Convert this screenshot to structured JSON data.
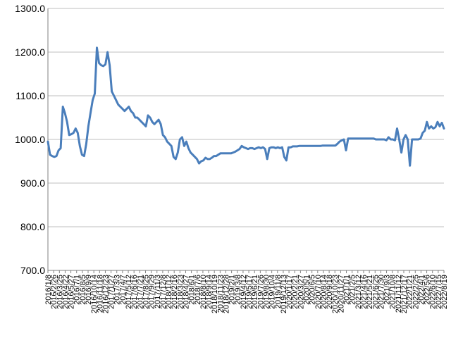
{
  "chart_data": {
    "type": "line",
    "title": "",
    "xlabel": "",
    "ylabel": "",
    "ylim": [
      700,
      1300
    ],
    "y_ticks": [
      "1300.0",
      "1200.0",
      "1100.0",
      "1000.0",
      "900.0",
      "800.0",
      "700.0"
    ],
    "grid": "horizontal",
    "legend": "none",
    "line_color": "#4a7ebb",
    "x_tick_labels": [
      "2016/1/8",
      "2016/2/26",
      "2016/3/25",
      "2016/4/22",
      "2016/5/27",
      "2016/7/1",
      "2016/8/5",
      "2016/9/9",
      "2016/10/14",
      "2016/11/18",
      "2016/12/23",
      "2017/1/27",
      "2017/3/3",
      "2017/4/7",
      "2017/5/12",
      "2017/6/16",
      "2017/7/21",
      "2017/8/25",
      "2017/9/29",
      "2017/11/3",
      "2017/12/8",
      "2018/1/12",
      "2018/2/16",
      "2018/3/23",
      "2018/4/27",
      "2018/6/1",
      "2018/7/6",
      "2018/8/10",
      "2018/9/14",
      "2018/10/19",
      "2018/11/23",
      "2018/12/28",
      "2019/2/1",
      "2019/3/8",
      "2019/4/12",
      "2019/5/17",
      "2019/6/21",
      "2019/7/26",
      "2019/8/30",
      "2019/10/4",
      "2019/11/8",
      "2019/12/13",
      "2020/1/17",
      "2020/2/21",
      "2020/3/27",
      "2020/5/1",
      "2020/6/5",
      "2020/7/10",
      "2020/8/14",
      "2020/9/18",
      "2020/10/23",
      "2020/11/27",
      "2021/1/1",
      "2021/2/5",
      "2021/3/12",
      "2021/4/16",
      "2021/5/21",
      "2021/6/25",
      "2021/7/30",
      "2021/9/3",
      "2021/10/8",
      "2021/11/12",
      "2021/12/17",
      "2022/1/21",
      "2022/2/25",
      "2022/4/1",
      "2022/5/6",
      "2022/6/10",
      "2022/7/15",
      "2022/8/19"
    ],
    "series": [
      {
        "values": [
          995,
          965,
          962,
          960,
          962,
          975,
          980,
          1075,
          1060,
          1040,
          1010,
          1012,
          1015,
          1025,
          1015,
          985,
          965,
          962,
          990,
          1030,
          1060,
          1090,
          1105,
          1210,
          1175,
          1170,
          1168,
          1172,
          1200,
          1170,
          1110,
          1100,
          1090,
          1080,
          1075,
          1070,
          1065,
          1070,
          1075,
          1065,
          1060,
          1050,
          1050,
          1045,
          1040,
          1035,
          1030,
          1055,
          1050,
          1040,
          1035,
          1040,
          1045,
          1035,
          1010,
          1005,
          995,
          990,
          985,
          960,
          955,
          970,
          1000,
          1005,
          985,
          995,
          980,
          970,
          965,
          960,
          955,
          945,
          950,
          952,
          958,
          955,
          955,
          958,
          962,
          962,
          965,
          968,
          968,
          968,
          968,
          968,
          968,
          970,
          972,
          975,
          978,
          985,
          982,
          980,
          978,
          980,
          980,
          978,
          980,
          982,
          980,
          982,
          978,
          955,
          980,
          982,
          982,
          980,
          982,
          980,
          982,
          960,
          952,
          982,
          982,
          984,
          984,
          984,
          985,
          985,
          985,
          985,
          985,
          985,
          985,
          985,
          985,
          985,
          985,
          986,
          986,
          986,
          986,
          986,
          986,
          986,
          990,
          995,
          998,
          1000,
          975,
          1002,
          1002,
          1002,
          1002,
          1002,
          1002,
          1002,
          1002,
          1002,
          1002,
          1002,
          1002,
          1002,
          1000,
          1000,
          1000,
          1000,
          1000,
          998,
          1005,
          1000,
          1000,
          998,
          1025,
          1000,
          970,
          1000,
          1010,
          1000,
          940,
          1000,
          1000,
          1000,
          1000,
          1002,
          1015,
          1020,
          1040,
          1025,
          1030,
          1025,
          1028,
          1040,
          1030,
          1038,
          1025
        ]
      }
    ]
  }
}
